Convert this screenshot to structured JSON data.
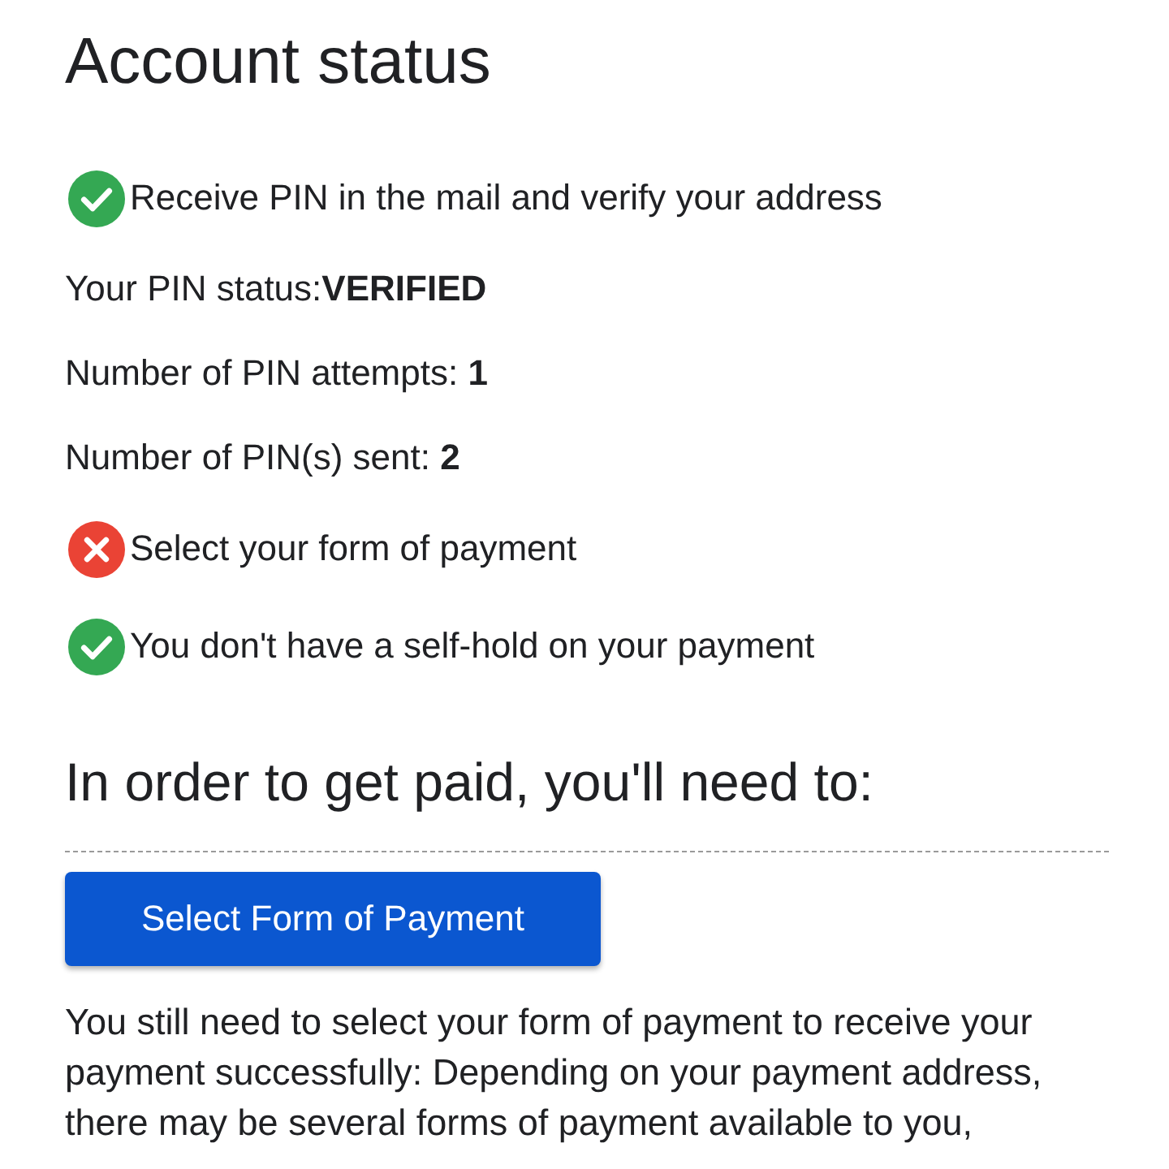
{
  "title": "Account status",
  "checklist": [
    {
      "kind": "status",
      "done": true,
      "text": "Receive PIN in the mail and verify your address"
    },
    {
      "kind": "detail",
      "text": "Your PIN status:**VERIFIED**"
    },
    {
      "kind": "detail",
      "text": "Number of PIN attempts: **1**"
    },
    {
      "kind": "detail",
      "text": "Number of PIN(s) sent: **2**"
    },
    {
      "kind": "status",
      "done": false,
      "text": "Select your form of payment"
    },
    {
      "kind": "status",
      "done": true,
      "text": "You don't have a self-hold on your payment"
    }
  ],
  "next_steps": {
    "heading": "In order to get paid, you'll need to:",
    "button": "Select Form of Payment",
    "description": "You still need to select your form of payment to receive your payment successfully: Depending on your payment address, there may be several forms of payment available to you,"
  }
}
